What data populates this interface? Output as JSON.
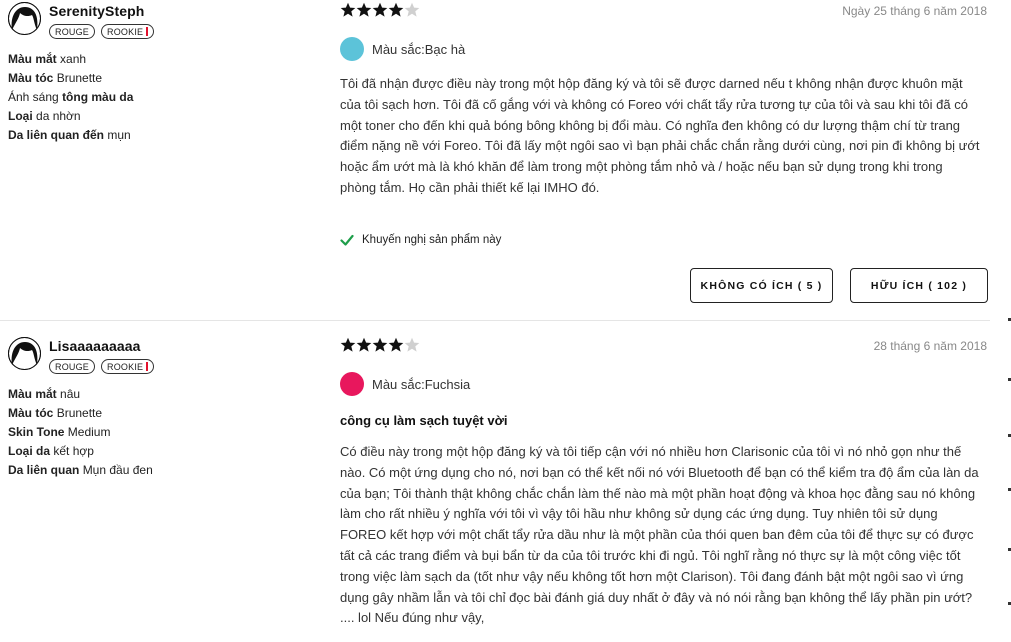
{
  "reviews": [
    {
      "username": "SerenitySteph",
      "badges": [
        "ROUGE",
        "ROOKIE"
      ],
      "attributes": [
        {
          "label": "Màu mắt",
          "value": "xanh"
        },
        {
          "label": "Màu tóc",
          "value": "Brunette"
        },
        {
          "label_pre": "Ánh sáng",
          "label": "tông màu da",
          "value": ""
        },
        {
          "label": "Loại",
          "value": "da nhờn"
        },
        {
          "label": "Da liên quan đến",
          "value": "mụn"
        }
      ],
      "rating": 4,
      "rating_max": 5,
      "date": "Ngày 25 tháng 6 năm 2018",
      "color_label": "Màu sắc:Bạc hà",
      "swatch_color": "#5cc3d9",
      "headline": "",
      "body": "Tôi đã nhận được điều này trong một hộp đăng ký và tôi sẽ được darned nếu t không nhận được khuôn mặt của tôi sạch hơn. Tôi đã cố gắng với và không có Foreo với chất tẩy rửa tương tự của tôi và sau khi tôi đã có một toner cho đến khi quả bóng bông không bị đổi màu. Có nghĩa đen không có dư lượng thậm chí từ trang điểm nặng nề với Foreo. Tôi đã lấy một ngôi sao vì bạn phải chắc chắn rằng dưới cùng, nơi pin đi không bị ướt hoặc ẩm ướt mà là khó khăn để làm trong một phòng tắm nhỏ và / hoặc nếu bạn sử dụng trong khi trong phòng tắm. Họ cần phải thiết kế lại IMHO đó.",
      "recommend": "Khuyến nghị sản phẩm này",
      "not_helpful": "KHÔNG CÓ ÍCH ( 5 )",
      "helpful": "HỮU ÍCH ( 102 )"
    },
    {
      "username": "Lisaaaaaaaaa",
      "badges": [
        "ROUGE",
        "ROOKIE"
      ],
      "attributes": [
        {
          "label": "Màu mắt",
          "value": "nâu"
        },
        {
          "label": "Màu tóc",
          "value": "Brunette"
        },
        {
          "label": "Skin Tone",
          "value": "Medium"
        },
        {
          "label": "Loại da",
          "value": "kết hợp"
        },
        {
          "label": "Da liên quan",
          "value": "Mụn đầu đen"
        }
      ],
      "rating": 4,
      "rating_max": 5,
      "date": "28 tháng 6 năm 2018",
      "color_label": "Màu sắc:Fuchsia",
      "swatch_color": "#e8175d",
      "headline": "công cụ làm sạch tuyệt vời",
      "body": "Có điều này trong một hộp đăng ký và tôi tiếp cận với nó nhiều hơn Clarisonic của tôi vì nó nhỏ gọn như thế nào. Có một ứng dụng cho nó, nơi bạn có thể kết nối nó với Bluetooth để bạn có thể kiểm tra độ ẩm của làn da của bạn; Tôi thành thật không chắc chắn làm thế nào mà một phần hoạt động và khoa học đằng sau nó không làm cho rất nhiều ý nghĩa với tôi vì vậy tôi hầu như không sử dụng các ứng dụng. Tuy nhiên tôi sử dụng FOREO kết hợp với một chất tẩy rửa dầu như là một phần của thói quen ban đêm của tôi để thực sự có được tất cả các trang điểm và bụi bẩn từ da của tôi trước khi đi ngủ. Tôi nghĩ rằng nó thực sự là một công việc tốt trong việc làm sạch da (tốt như vậy nếu không tốt hơn một Clarison). Tôi đang đánh bật một ngôi sao vì ứng dụng gây nhầm lẫn và tôi chỉ đọc bài đánh giá duy nhất ở đây và nó nói rằng bạn không thể lấy phần pin ướt? .... lol Nếu đúng như vậy,"
    }
  ]
}
